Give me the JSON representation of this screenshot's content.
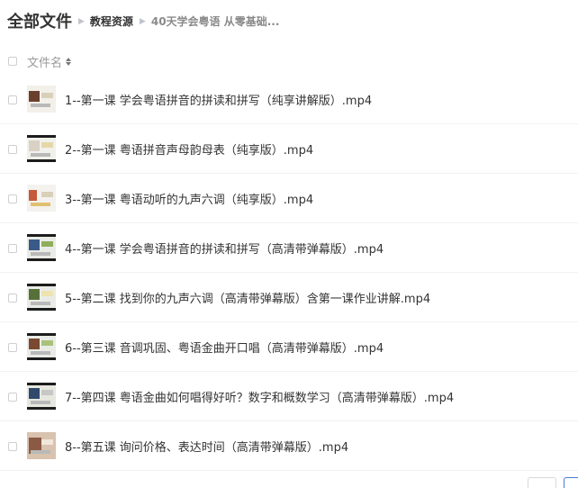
{
  "breadcrumb": {
    "root": "全部文件",
    "items": [
      "教程资源",
      "40天学会粤语 从零基础..."
    ]
  },
  "list_header": {
    "column_name": "文件名"
  },
  "files": [
    {
      "name": "1--第一课 学会粤语拼音的拼读和拼写（纯享讲解版）.mp4"
    },
    {
      "name": "2--第一课 粤语拼音声母韵母表（纯享版）.mp4"
    },
    {
      "name": "3--第一课 粤语动听的九声六调（纯享版）.mp4"
    },
    {
      "name": "4--第一课 学会粤语拼音的拼读和拼写（高清带弹幕版）.mp4"
    },
    {
      "name": "5--第二课 找到你的九声六调（高清带弹幕版）含第一课作业讲解.mp4"
    },
    {
      "name": "6--第三课 音调巩固、粤语金曲开口唱（高清带弹幕版）.mp4"
    },
    {
      "name": "7--第四课 粤语金曲如何唱得好听？数字和概数学习（高清带弹幕版）.mp4"
    },
    {
      "name": "8--第五课 询问价格、表达时间（高清带弹幕版）.mp4"
    }
  ],
  "icons": {
    "breadcrumb_separator": "triangle-right-icon",
    "sort": "sort-icon",
    "thumbnail": "video-thumbnail"
  }
}
